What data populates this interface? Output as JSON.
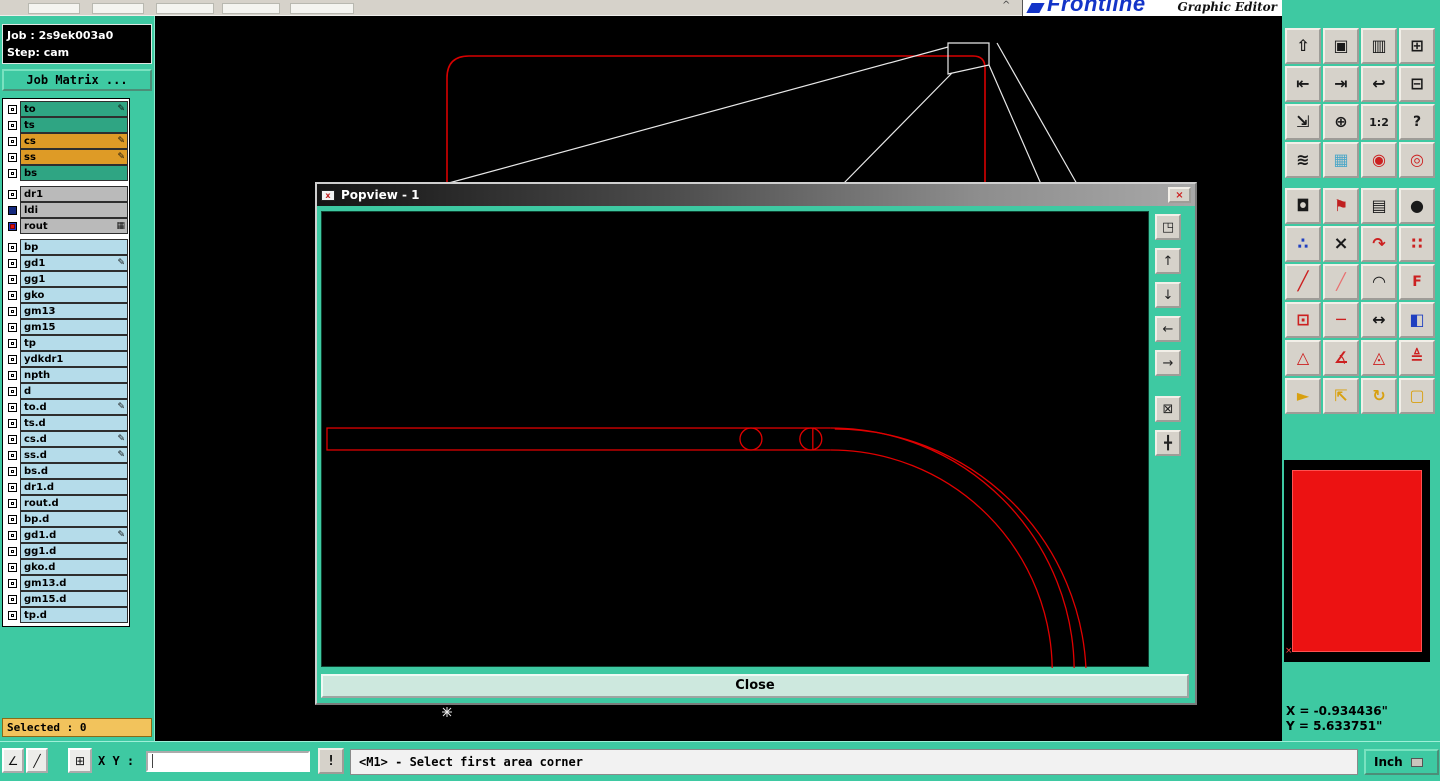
{
  "window": {
    "brand": "Frontline",
    "brand_sub": "Graphic Editor"
  },
  "left_panel": {
    "job_line": "Job : 2s9ek003a0",
    "step_line": "Step: cam",
    "job_matrix_label": "Job Matrix ...",
    "selected_label": "Selected : 0",
    "layers_group1": [
      {
        "label": "to",
        "bg": "#2FA583",
        "icon": "✎",
        "cb": ""
      },
      {
        "label": "ts",
        "bg": "#2FA583",
        "icon": "",
        "cb": ""
      },
      {
        "label": "cs",
        "bg": "#DE9B26",
        "icon": "✎",
        "cb": ""
      },
      {
        "label": "ss",
        "bg": "#DE9B26",
        "icon": "✎",
        "cb": ""
      },
      {
        "label": "bs",
        "bg": "#2FA583",
        "icon": "",
        "cb": ""
      }
    ],
    "layers_group2": [
      {
        "label": "dr1",
        "bg": "#BABABA",
        "icon": "",
        "cb": ""
      },
      {
        "label": "ldi",
        "bg": "#BABABA",
        "icon": "",
        "cb": "navy"
      },
      {
        "label": "rout",
        "bg": "#BABABA",
        "icon": "▦",
        "cb": "bluered"
      }
    ],
    "layers_group3": [
      {
        "label": "bp",
        "bg": "#B5DCEA",
        "icon": "",
        "cb": ""
      },
      {
        "label": "gd1",
        "bg": "#B5DCEA",
        "icon": "✎",
        "cb": ""
      },
      {
        "label": "gg1",
        "bg": "#B5DCEA",
        "icon": "",
        "cb": ""
      },
      {
        "label": "gko",
        "bg": "#B5DCEA",
        "icon": "",
        "cb": ""
      },
      {
        "label": "gm13",
        "bg": "#B5DCEA",
        "icon": "",
        "cb": ""
      },
      {
        "label": "gm15",
        "bg": "#B5DCEA",
        "icon": "",
        "cb": ""
      },
      {
        "label": "tp",
        "bg": "#B5DCEA",
        "icon": "",
        "cb": ""
      },
      {
        "label": "ydkdr1",
        "bg": "#B5DCEA",
        "icon": "",
        "cb": ""
      },
      {
        "label": "npth",
        "bg": "#B5DCEA",
        "icon": "",
        "cb": ""
      },
      {
        "label": "d",
        "bg": "#B5DCEA",
        "icon": "",
        "cb": ""
      },
      {
        "label": "to.d",
        "bg": "#B5DCEA",
        "icon": "✎",
        "cb": ""
      },
      {
        "label": "ts.d",
        "bg": "#B5DCEA",
        "icon": "",
        "cb": ""
      },
      {
        "label": "cs.d",
        "bg": "#B5DCEA",
        "icon": "✎",
        "cb": ""
      },
      {
        "label": "ss.d",
        "bg": "#B5DCEA",
        "icon": "✎",
        "cb": ""
      },
      {
        "label": "bs.d",
        "bg": "#B5DCEA",
        "icon": "",
        "cb": ""
      },
      {
        "label": "dr1.d",
        "bg": "#B5DCEA",
        "icon": "",
        "cb": ""
      },
      {
        "label": "rout.d",
        "bg": "#B5DCEA",
        "icon": "",
        "cb": ""
      },
      {
        "label": "bp.d",
        "bg": "#B5DCEA",
        "icon": "",
        "cb": ""
      },
      {
        "label": "gd1.d",
        "bg": "#B5DCEA",
        "icon": "✎",
        "cb": ""
      },
      {
        "label": "gg1.d",
        "bg": "#B5DCEA",
        "icon": "",
        "cb": ""
      },
      {
        "label": "gko.d",
        "bg": "#B5DCEA",
        "icon": "",
        "cb": ""
      },
      {
        "label": "gm13.d",
        "bg": "#B5DCEA",
        "icon": "",
        "cb": ""
      },
      {
        "label": "gm15.d",
        "bg": "#B5DCEA",
        "icon": "",
        "cb": ""
      },
      {
        "label": "tp.d",
        "bg": "#B5DCEA",
        "icon": "",
        "cb": ""
      }
    ]
  },
  "popup": {
    "title": "Popview - 1",
    "titlebar_icon": "x",
    "close_x": "×",
    "close_label": "Close",
    "tools": [
      {
        "name": "popup-copy-view-button",
        "glyph": "◳"
      },
      {
        "name": "popup-scroll-up-button",
        "glyph": "↑"
      },
      {
        "name": "popup-scroll-down-button",
        "glyph": "↓"
      },
      {
        "name": "popup-scroll-left-button",
        "glyph": "←"
      },
      {
        "name": "popup-scroll-right-button",
        "glyph": "→"
      },
      {
        "name": "popup-fit-view-button",
        "glyph": "⊠"
      },
      {
        "name": "popup-pan-button",
        "glyph": "╋"
      }
    ]
  },
  "right_panel": {
    "coord_x": "X = -0.934436\"",
    "coord_y": "Y = 5.633751\"",
    "preview_marker": "×",
    "tools_main": [
      {
        "name": "copy-screen-button",
        "glyph": "⇧"
      },
      {
        "name": "display-button",
        "glyph": "▣"
      },
      {
        "name": "ruler-button",
        "glyph": "▥"
      },
      {
        "name": "tile-windows-button",
        "glyph": "⊞"
      },
      {
        "name": "view-in-button",
        "glyph": "⇤"
      },
      {
        "name": "view-out-button",
        "glyph": "⇥"
      },
      {
        "name": "previous-view-button",
        "glyph": "↩"
      },
      {
        "name": "collapse-button",
        "glyph": "⊟"
      },
      {
        "name": "fit-window-button",
        "glyph": "⇲"
      },
      {
        "name": "center-view-button",
        "glyph": "⊕"
      },
      {
        "name": "zoom-ratio-button",
        "glyph": "1:2",
        "fs": 11
      },
      {
        "name": "help-button",
        "glyph": "?",
        "fs": 14
      },
      {
        "name": "redraw-button",
        "glyph": "≋"
      },
      {
        "name": "grid-toggle-button",
        "glyph": "▦",
        "color": "#4fa8c8"
      },
      {
        "name": "layer-order-button",
        "glyph": "◉",
        "color": "#cc2020"
      },
      {
        "name": "layer-swap-button",
        "glyph": "◎",
        "color": "#cc2020"
      }
    ],
    "tools_edit": [
      {
        "name": "origin-button",
        "glyph": "◘"
      },
      {
        "name": "active-layer-button",
        "glyph": "⚑",
        "color": "#c02020"
      },
      {
        "name": "measure-button",
        "glyph": "▤"
      },
      {
        "name": "aperture-button",
        "glyph": "●"
      },
      {
        "name": "pattern-button",
        "glyph": "∴",
        "color": "#2040c0"
      },
      {
        "name": "delete-button",
        "glyph": "×",
        "fs": 18
      },
      {
        "name": "rotate-button",
        "glyph": "↷",
        "color": "#cc2020"
      },
      {
        "name": "points-button",
        "glyph": "∷",
        "color": "#cc2020"
      },
      {
        "name": "line-button",
        "glyph": "╱",
        "color": "#cc2020",
        "fs": 18
      },
      {
        "name": "thin-line-button",
        "glyph": "╱",
        "color": "#e87070"
      },
      {
        "name": "arc-button",
        "glyph": "◠"
      },
      {
        "name": "fillet-button",
        "glyph": "F",
        "color": "#cc2020",
        "fs": 14
      },
      {
        "name": "pad-button",
        "glyph": "⊡",
        "color": "#cc2020"
      },
      {
        "name": "dash-button",
        "glyph": "─",
        "color": "#cc2020"
      },
      {
        "name": "width-button",
        "glyph": "↔"
      },
      {
        "name": "surface-button",
        "glyph": "◧",
        "color": "#2040c0"
      },
      {
        "name": "triangle-button",
        "glyph": "△",
        "color": "#cc2020"
      },
      {
        "name": "angle-button",
        "glyph": "∡",
        "color": "#cc2020"
      },
      {
        "name": "peak-button",
        "glyph": "◬",
        "color": "#cc2020"
      },
      {
        "name": "delta-button",
        "glyph": "≜",
        "color": "#cc2020"
      },
      {
        "name": "select-arrow-button",
        "glyph": "►",
        "color": "#d8a010"
      },
      {
        "name": "select-corner-button",
        "glyph": "⇱",
        "color": "#d8a010"
      },
      {
        "name": "select-rotate-button",
        "glyph": "↻",
        "color": "#d8a010"
      },
      {
        "name": "select-area-button",
        "glyph": "▢",
        "color": "#d8a010"
      }
    ]
  },
  "bottom_bar": {
    "tools": [
      {
        "name": "snap-angle-button",
        "glyph": "∠"
      },
      {
        "name": "snap-line-button",
        "glyph": "╱"
      },
      {
        "name": "coord-grid-button",
        "glyph": "⊞"
      }
    ],
    "xy_label": "X Y :",
    "input_value": "",
    "warn_label": "!",
    "message": "<M1> - Select first area corner",
    "unit_label": "Inch"
  }
}
